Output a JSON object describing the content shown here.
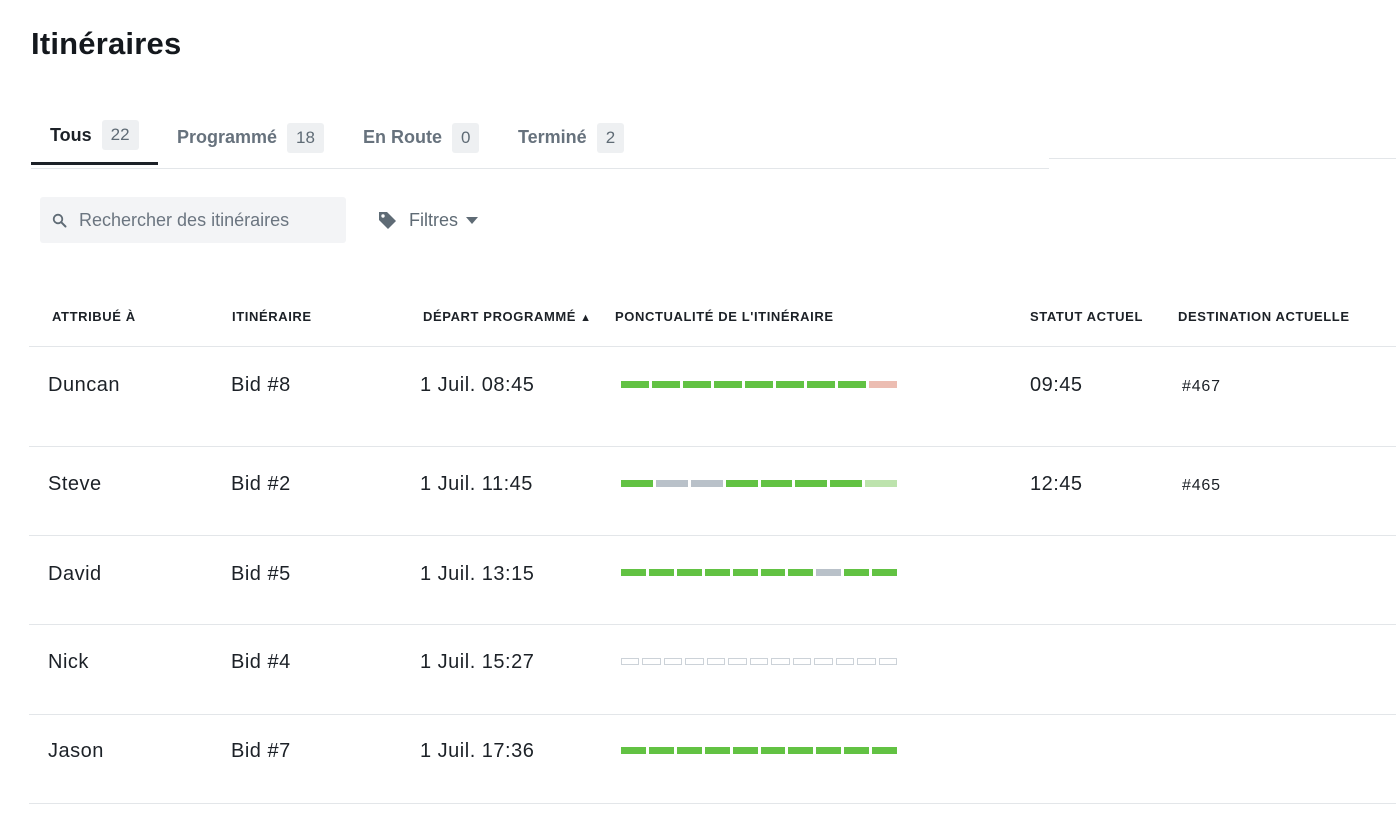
{
  "page": {
    "title": "Itinéraires"
  },
  "tabs": [
    {
      "label": "Tous",
      "count": "22",
      "active": true
    },
    {
      "label": "Programmé",
      "count": "18",
      "active": false
    },
    {
      "label": "En Route",
      "count": "0",
      "active": false
    },
    {
      "label": "Terminé",
      "count": "2",
      "active": false
    }
  ],
  "search": {
    "placeholder": "Rechercher des itinéraires",
    "value": ""
  },
  "filters": {
    "label": "Filtres"
  },
  "table": {
    "columns": {
      "assigned": "ATTRIBUÉ À",
      "route": "ITINÉRAIRE",
      "departure": "DÉPART PROGRAMMÉ",
      "departure_sort": "▲",
      "punctuality": "PONCTUALITÉ DE L'ITINÉRAIRE",
      "status": "STATUT ACTUEL",
      "destination": "DESTINATION ACTUELLE"
    },
    "rows": [
      {
        "assigned": "Duncan",
        "route": "Bid #8",
        "departure": "1 Juil. 08:45",
        "status": "09:45",
        "destination": "#467",
        "punctuality": [
          "green",
          "green",
          "green",
          "green",
          "green",
          "green",
          "green",
          "green",
          "pink"
        ]
      },
      {
        "assigned": "Steve",
        "route": "Bid #2",
        "departure": "1 Juil. 11:45",
        "status": "12:45",
        "destination": "#465",
        "punctuality": [
          "green",
          "gray",
          "gray",
          "green",
          "green",
          "green",
          "green",
          "lightgreen"
        ]
      },
      {
        "assigned": "David",
        "route": "Bid #5",
        "departure": "1 Juil. 13:15",
        "status": "",
        "destination": "",
        "punctuality": [
          "green",
          "green",
          "green",
          "green",
          "green",
          "green",
          "green",
          "gray",
          "green",
          "green"
        ]
      },
      {
        "assigned": "Nick",
        "route": "Bid #4",
        "departure": "1 Juil. 15:27",
        "status": "",
        "destination": "",
        "punctuality": [
          "empty",
          "empty",
          "empty",
          "empty",
          "empty",
          "empty",
          "empty",
          "empty",
          "empty",
          "empty",
          "empty",
          "empty",
          "empty"
        ]
      },
      {
        "assigned": "Jason",
        "route": "Bid #7",
        "departure": "1 Juil. 17:36",
        "status": "",
        "destination": "",
        "punctuality": [
          "green",
          "green",
          "green",
          "green",
          "green",
          "green",
          "green",
          "green",
          "green",
          "green"
        ]
      }
    ]
  },
  "colors": {
    "green": "#62c243",
    "gray": "#b9c1c9",
    "pink": "#ecbdb2",
    "lightgreen": "#bde3ad",
    "empty": "#ffffff"
  },
  "icons": {
    "search": "search-icon",
    "filters": "tag-icon",
    "filters_caret": "caret-down-icon"
  }
}
